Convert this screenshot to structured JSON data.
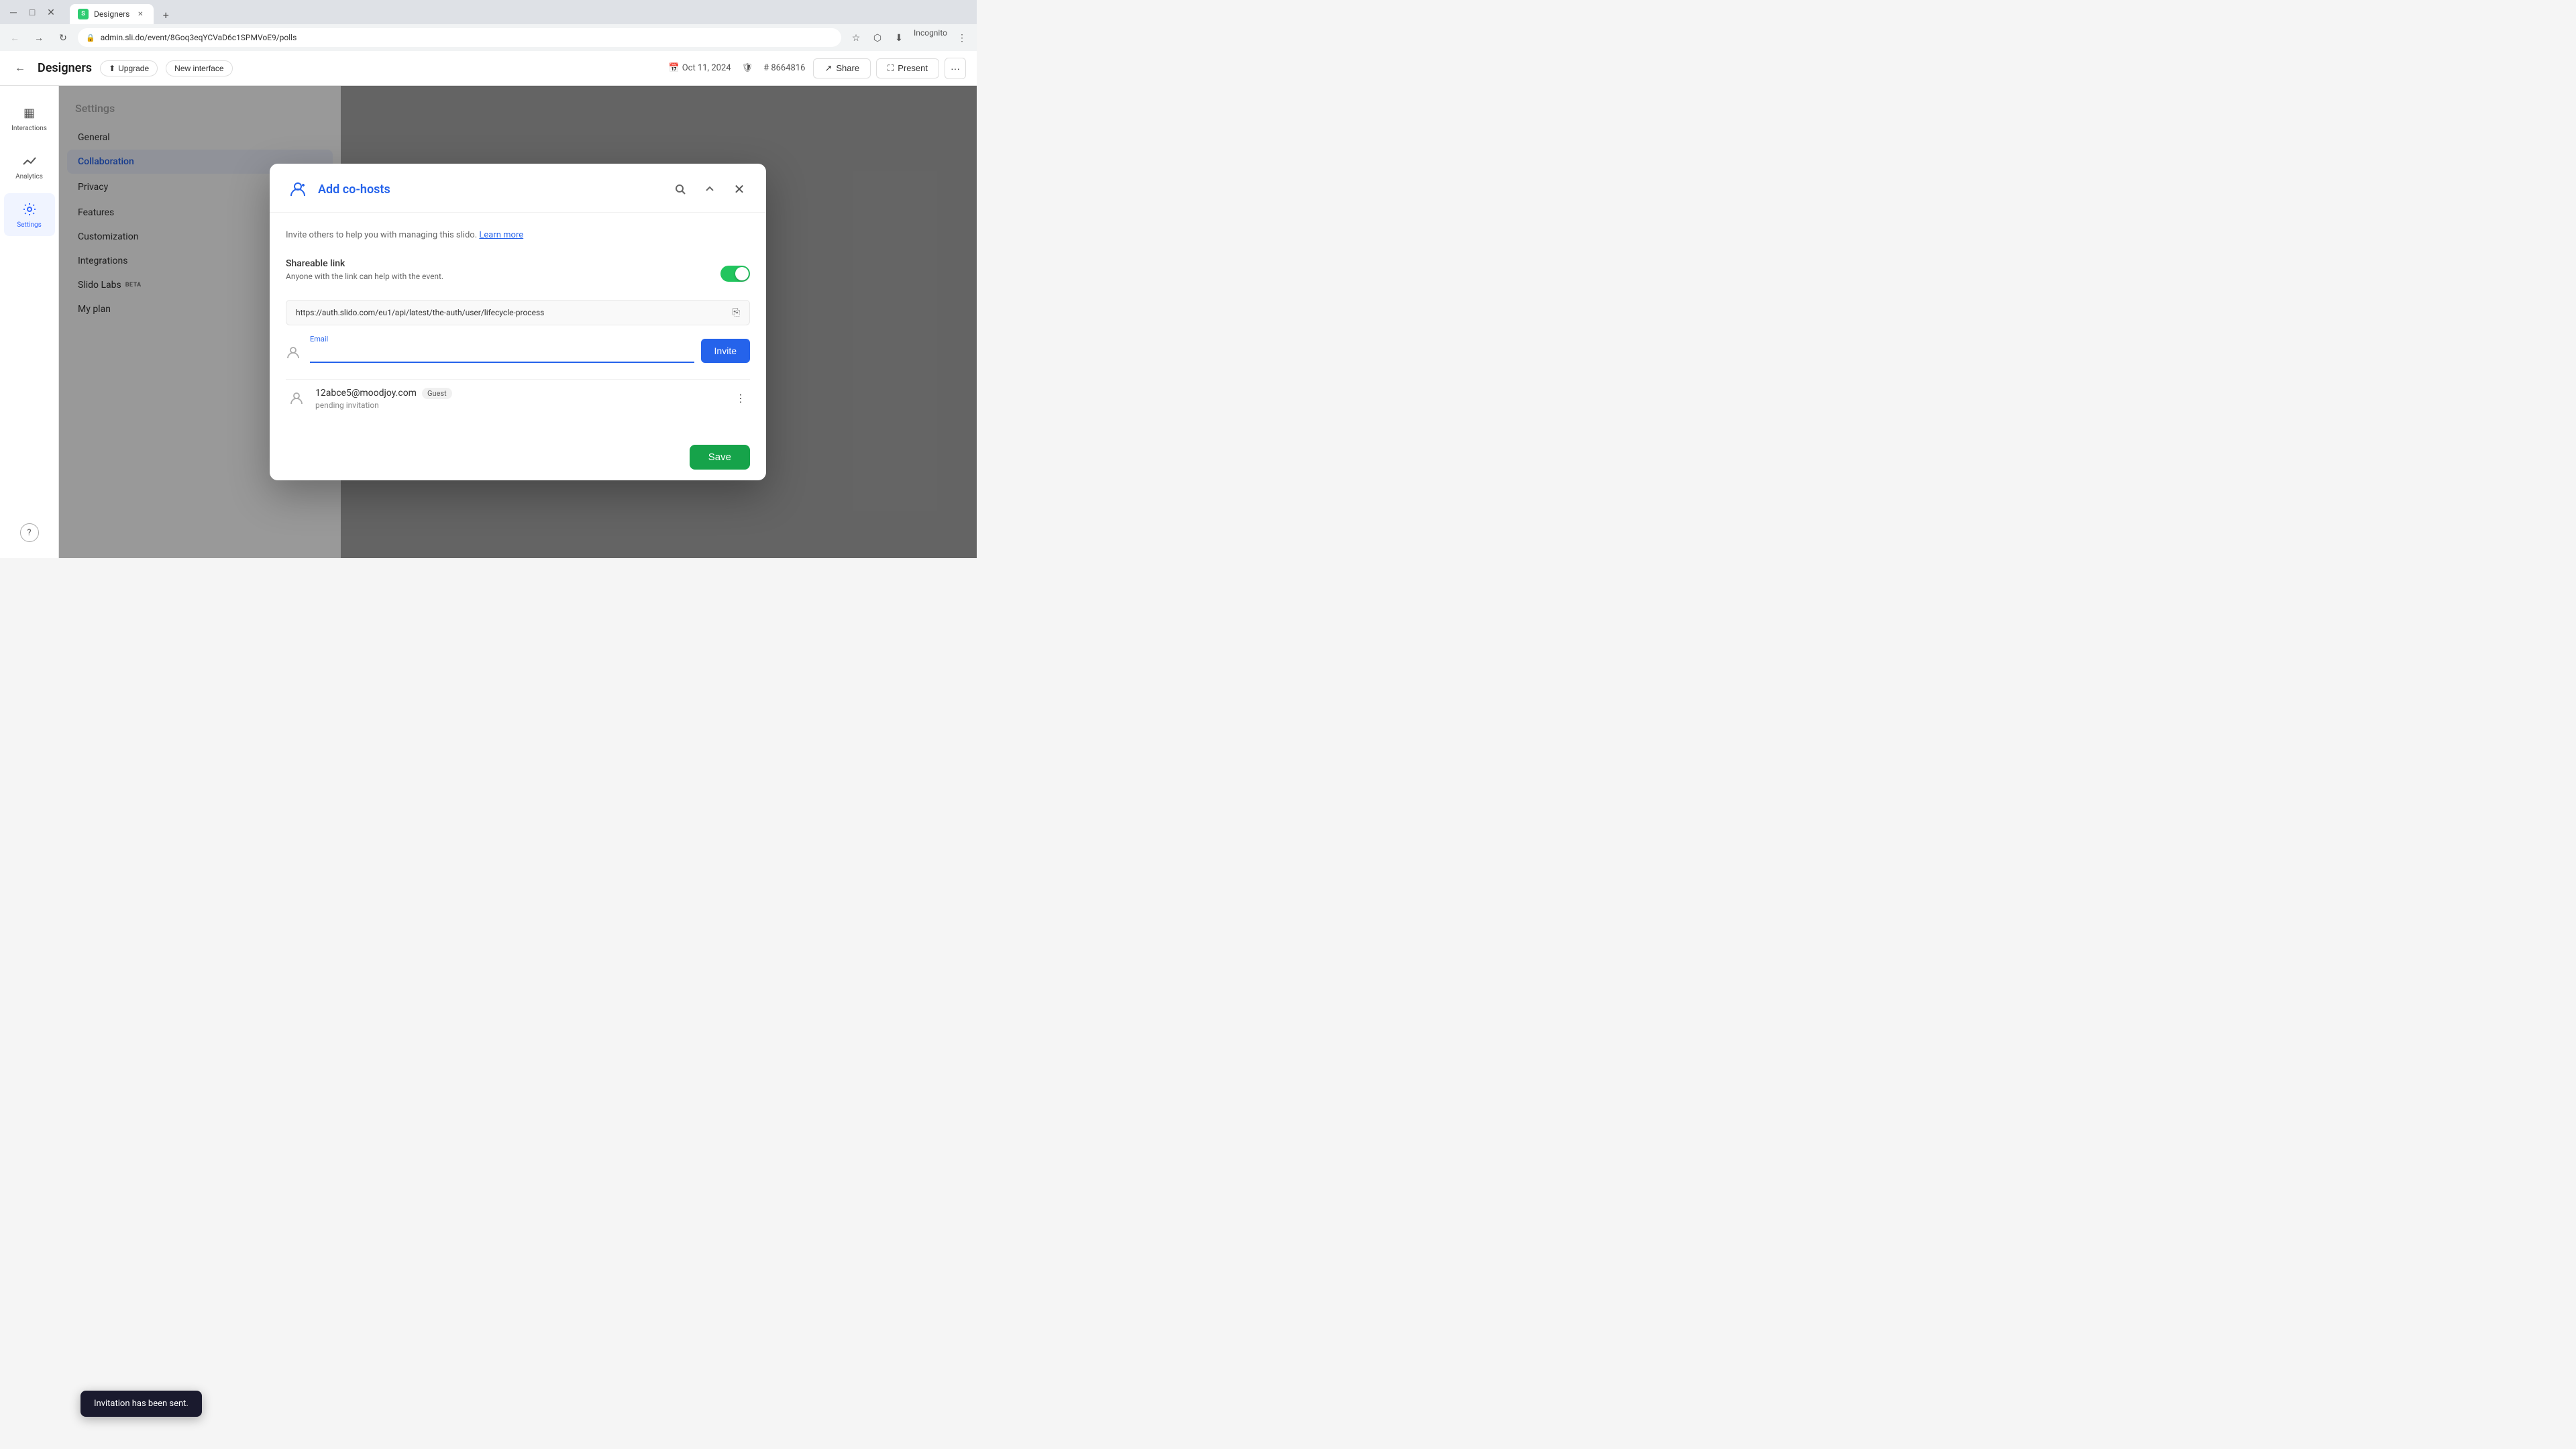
{
  "browser": {
    "url": "admin.sli.do/event/8Goq3eqYCVaD6c1SPMVoE9/polls",
    "tab_title": "Designers",
    "favicon_letter": "S"
  },
  "topbar": {
    "back_label": "←",
    "app_title": "Designers",
    "upgrade_label": "Upgrade",
    "new_interface_label": "New interface",
    "date_label": "Oct 11, 2024",
    "event_id_label": "# 8664816",
    "share_label": "Share",
    "present_label": "Present",
    "more_label": "···"
  },
  "sidebar": {
    "items": [
      {
        "label": "Interactions",
        "icon": "▦"
      },
      {
        "label": "Analytics",
        "icon": "↗"
      },
      {
        "label": "Settings",
        "icon": "⚙"
      }
    ],
    "active_index": 2,
    "help_label": "?"
  },
  "settings": {
    "title": "Settings",
    "nav_items": [
      {
        "label": "General",
        "active": false,
        "has_icon": false
      },
      {
        "label": "Collaboration",
        "active": true,
        "has_icon": false
      },
      {
        "label": "Privacy",
        "active": false,
        "has_icon": true
      },
      {
        "label": "Features",
        "active": false,
        "has_icon": false
      },
      {
        "label": "Customization",
        "active": false,
        "has_icon": false
      },
      {
        "label": "Integrations",
        "active": false,
        "has_icon": false
      },
      {
        "label": "Slido Labs",
        "active": false,
        "has_icon": false,
        "badge": "BETA"
      },
      {
        "label": "My plan",
        "active": false,
        "has_icon": false
      }
    ]
  },
  "modal": {
    "title": "Add co-hosts",
    "description": "Invite others to help you with managing this slido.",
    "learn_more_label": "Learn more",
    "shareable_link_label": "Shareable link",
    "shareable_link_sublabel": "Anyone with the link can help with the event.",
    "link_url": "https://auth.slido.com/eu1/api/latest/the-auth/user/lifecycle-process",
    "email_label": "Email",
    "email_placeholder": "",
    "invite_label": "Invite",
    "toggle_on": true,
    "user": {
      "email": "12abce5@moodjoy.com",
      "role": "Guest",
      "status": "pending invitation"
    },
    "save_label": "Save"
  },
  "toast": {
    "message": "Invitation has been sent."
  }
}
